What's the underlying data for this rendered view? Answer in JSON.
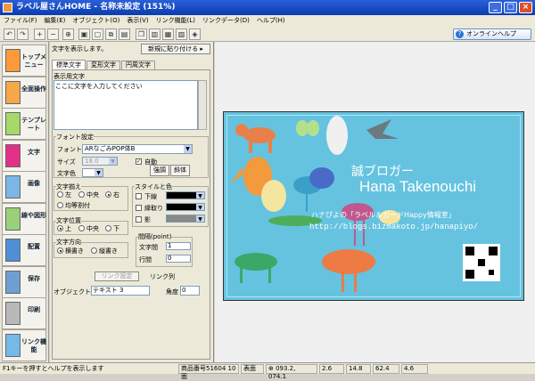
{
  "window": {
    "title": "ラベル屋さんHOME - 名称未設定 (151%)"
  },
  "menu": [
    "ファイル(F)",
    "編集(E)",
    "オブジェクト(O)",
    "表示(V)",
    "リンク機能(L)",
    "リンクデータ(D)",
    "ヘルプ(H)"
  ],
  "toolbar": {
    "help_label": "オンラインヘルプ"
  },
  "sidebar": [
    {
      "label": "トップメニュー",
      "icon": "home-icon",
      "color": "#ff9a3c"
    },
    {
      "label": "全面操作",
      "icon": "all-edit-icon",
      "color": "#f5a74a"
    },
    {
      "label": "テンプレート",
      "icon": "template-icon",
      "color": "#a6d86a"
    },
    {
      "label": "文字",
      "icon": "text-icon",
      "color": "#e23089"
    },
    {
      "label": "画像",
      "icon": "image-icon",
      "color": "#7cb6e6"
    },
    {
      "label": "線や図形",
      "icon": "shape-icon",
      "color": "#9bd07a"
    },
    {
      "label": "配置",
      "icon": "layout-icon",
      "color": "#4f8fd6"
    },
    {
      "label": "保存",
      "icon": "save-icon",
      "color": "#6e9fd4"
    },
    {
      "label": "印刷",
      "icon": "print-icon",
      "color": "#b9b9b9"
    },
    {
      "label": "リンク機能",
      "icon": "link-icon",
      "color": "#75b9e8"
    }
  ],
  "panel": {
    "header": "文字を表示します。",
    "new_paste": "新規に貼り付ける",
    "tabs": [
      "標準文字",
      "変形文字",
      "円周文字"
    ],
    "text_section": "表示用文字",
    "text_placeholder": "ここに文字を入力してください",
    "font_section": "フォント設定",
    "font_label": "フォント",
    "font_value": "ARなごみPOP体B",
    "size_label": "サイズ",
    "size_value": "18.0",
    "auto_label": "自動",
    "color_label": "文字色",
    "bold_label": "強調",
    "italic_label": "斜体",
    "align_section": "文字揃え",
    "align_left": "左",
    "align_center": "中央",
    "align_right": "右",
    "align_even": "均等割付",
    "vpos_section": "文字位置",
    "vpos_top": "上",
    "vpos_mid": "中央",
    "vpos_bottom": "下",
    "dir_section": "文字方向",
    "dir_h": "横書き",
    "dir_v": "縦書き",
    "style_section": "スタイルと色",
    "underline": "下線",
    "outline": "縁取り",
    "shadow": "影",
    "spacing_section": "間隔(point)",
    "char_spacing": "文字間",
    "char_spacing_val": "1",
    "line_spacing": "行間",
    "line_spacing_val": "0",
    "link_setting": "リンク設定",
    "link_col": "リンク列",
    "obj_name_label": "オブジェクト名",
    "obj_name_value": "テキスト 3",
    "angle_label": "角度",
    "angle_value": "0"
  },
  "card": {
    "title": "誠ブロガー",
    "name": "Hana Takenouchi",
    "tagline": "ハナぴよの「ラベル＆カードHappy情報室」",
    "url": "http://blogs.bizmakoto.jp/hanapiyo/",
    "bg": "#65c3e0"
  },
  "status": {
    "hint": "F1キーを押すとヘルプを表示します",
    "product": "商品番号51604 10面",
    "side": "表面",
    "coord": "093.2, 074.1",
    "size_w": "2.6",
    "size_h": "14.8",
    "dim_w": "62.4",
    "dim_h": "4.6"
  }
}
